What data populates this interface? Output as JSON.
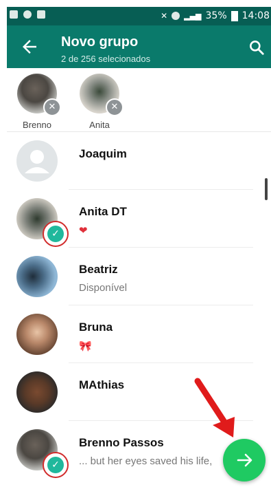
{
  "statusbar": {
    "battery": "35%",
    "time": "14:08"
  },
  "header": {
    "title": "Novo grupo",
    "subtitle": "2 de 256 selecionados",
    "back_icon": "arrow-left-icon",
    "search_icon": "search-icon"
  },
  "selected": [
    {
      "name": "Brenno"
    },
    {
      "name": "Anita"
    }
  ],
  "contacts": [
    {
      "name": "Joaquim",
      "status": "",
      "selected": false
    },
    {
      "name": "Anita DT",
      "status": "❤",
      "selected": true
    },
    {
      "name": "Beatriz",
      "status": "Disponível",
      "selected": false
    },
    {
      "name": "Bruna",
      "status": "🎀",
      "selected": false
    },
    {
      "name": "MAthias",
      "status": "",
      "selected": false
    },
    {
      "name": "Brenno Passos",
      "status": "... but her eyes saved his life,",
      "selected": true
    }
  ],
  "fab_icon": "arrow-right-icon",
  "colors": {
    "toolbar": "#0a7a6b",
    "statusbar": "#075e54",
    "accent": "#20b89c",
    "fab": "#1fca62",
    "annotation": "#e01b1b"
  }
}
